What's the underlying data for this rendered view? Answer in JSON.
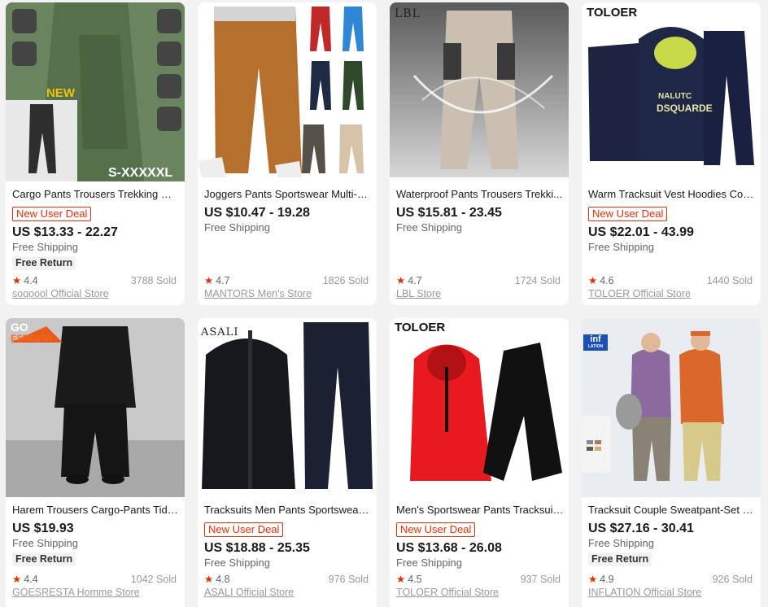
{
  "products": [
    {
      "title": "Cargo Pants Trousers Trekking Mu...",
      "deal": "New User Deal",
      "price": "US $13.33 - 22.27",
      "shipping": "Free Shipping",
      "free_return": "Free Return",
      "rating": "4.4",
      "sold": "3788 Sold",
      "store": "soqoool Official Store",
      "image_overlay": {
        "new": "NEW",
        "size": "S-XXXXXL"
      }
    },
    {
      "title": "Joggers Pants Sportswear Multi-Po...",
      "price": "US $10.47 - 19.28",
      "shipping": "Free Shipping",
      "rating": "4.7",
      "sold": "1826 Sold",
      "store": "MANTORS Men's Store"
    },
    {
      "title": "Waterproof Pants Trousers Trekki...",
      "price": "US $15.81 - 23.45",
      "shipping": "Free Shipping",
      "rating": "4.7",
      "sold": "1724 Sold",
      "store": "LBL Store",
      "image_overlay": {
        "brand": "LBL"
      }
    },
    {
      "title": "Warm Tracksuit Vest Hoodies Coat...",
      "deal": "New User Deal",
      "price": "US $22.01 - 43.99",
      "shipping": "Free Shipping",
      "rating": "4.6",
      "sold": "1440 Sold",
      "store": "TOLOER Official Store",
      "image_overlay": {
        "brand": "TOLOER",
        "print1": "NALUTC",
        "print2": "DSQUARDE"
      }
    },
    {
      "title": "Harem Trousers Cargo-Pants Tide-...",
      "price": "US $19.93",
      "shipping": "Free Shipping",
      "free_return": "Free Return",
      "rating": "4.4",
      "sold": "1042 Sold",
      "store": "GOESRESTA Homme Store",
      "image_overlay": {
        "brand1": "GO",
        "brand2": "ESRESTA"
      }
    },
    {
      "title": "Tracksuits Men Pants Sportswear J...",
      "deal": "New User Deal",
      "price": "US $18.88 - 25.35",
      "shipping": "Free Shipping",
      "rating": "4.8",
      "sold": "976 Sold",
      "store": "ASALI Official Store",
      "image_overlay": {
        "brand": "ASALI"
      }
    },
    {
      "title": "Men's Sportswear Pants Tracksuits...",
      "deal": "New User Deal",
      "price": "US $13.68 - 26.08",
      "shipping": "Free Shipping",
      "rating": "4.5",
      "sold": "937 Sold",
      "store": "TOLOER Official Store",
      "image_overlay": {
        "brand": "TOLOER"
      }
    },
    {
      "title": "Tracksuit Couple Sweatpant-Set M...",
      "price": "US $27.16 - 30.41",
      "shipping": "Free Shipping",
      "free_return": "Free Return",
      "rating": "4.9",
      "sold": "926 Sold",
      "store": "INFLATION Official Store",
      "image_overlay": {
        "brand1": "inf",
        "brand2": "LATION"
      }
    }
  ],
  "colors": {
    "accent": "#e62e04",
    "star": "#e62e04",
    "card_bg": "#ffffff",
    "page_bg": "#f2f2f2"
  }
}
